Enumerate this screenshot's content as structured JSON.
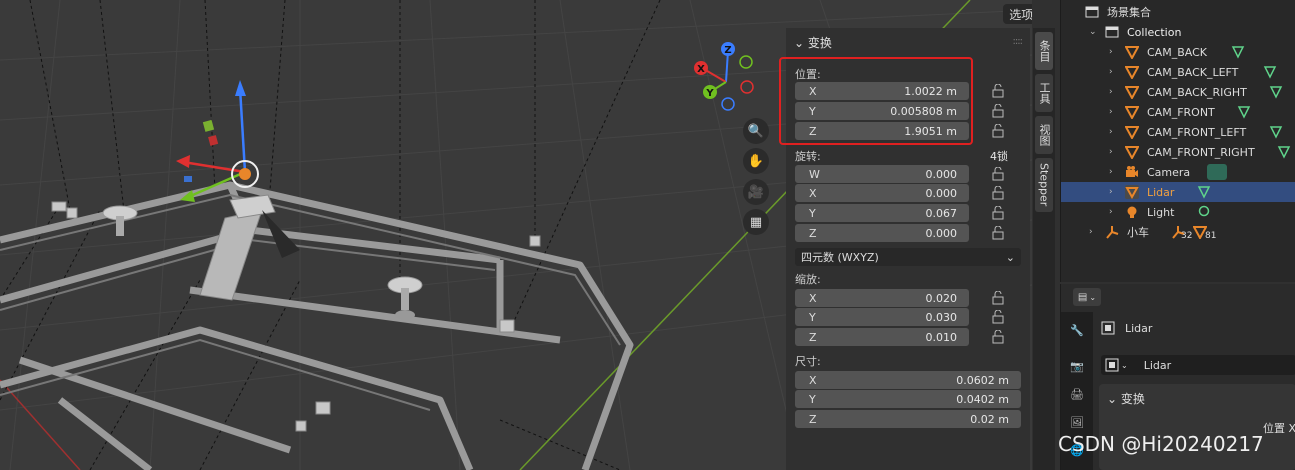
{
  "viewport": {
    "options_label": "选项"
  },
  "gizmo": {
    "x": "X",
    "y": "Y",
    "z": "Z"
  },
  "npanel": {
    "title": "变换",
    "location_label": "位置:",
    "location": [
      {
        "axis": "X",
        "value": "1.0022 m"
      },
      {
        "axis": "Y",
        "value": "0.005808 m"
      },
      {
        "axis": "Z",
        "value": "1.9051 m"
      }
    ],
    "rotation_label": "旋转:",
    "rotation_lock_label": "4锁",
    "rotation": [
      {
        "axis": "W",
        "value": "0.000"
      },
      {
        "axis": "X",
        "value": "0.000"
      },
      {
        "axis": "Y",
        "value": "0.067"
      },
      {
        "axis": "Z",
        "value": "0.000"
      }
    ],
    "rotation_mode": "四元数 (WXYZ)",
    "scale_label": "缩放:",
    "scale": [
      {
        "axis": "X",
        "value": "0.020"
      },
      {
        "axis": "Y",
        "value": "0.030"
      },
      {
        "axis": "Z",
        "value": "0.010"
      }
    ],
    "dimensions_label": "尺寸:",
    "dimensions": [
      {
        "axis": "X",
        "value": "0.0602 m"
      },
      {
        "axis": "Y",
        "value": "0.0402 m"
      },
      {
        "axis": "Z",
        "value": "0.02 m"
      }
    ]
  },
  "tabs": [
    "条目",
    "工具",
    "视图",
    "Stepper"
  ],
  "outliner": {
    "scene_collection": "场景集合",
    "collection": "Collection",
    "items": [
      {
        "name": "CAM_BACK",
        "type": "camera"
      },
      {
        "name": "CAM_BACK_LEFT",
        "type": "camera"
      },
      {
        "name": "CAM_BACK_RIGHT",
        "type": "camera"
      },
      {
        "name": "CAM_FRONT",
        "type": "camera"
      },
      {
        "name": "CAM_FRONT_LEFT",
        "type": "camera"
      },
      {
        "name": "CAM_FRONT_RIGHT",
        "type": "camera"
      },
      {
        "name": "Camera",
        "type": "camera"
      },
      {
        "name": "Lidar",
        "type": "camera",
        "selected": true
      },
      {
        "name": "Light",
        "type": "light"
      }
    ],
    "armature": {
      "name": "小车",
      "count_a": "32",
      "count_b": "81"
    }
  },
  "properties": {
    "object_name": "Lidar",
    "object_field": "Lidar",
    "transform_title": "变换",
    "location_label": "位置 X"
  },
  "watermark": "CSDN @Hi20240217",
  "colors": {
    "accent_orange": "#e8862a",
    "selection_blue": "#334d80",
    "highlight_red": "#e02020",
    "data_green": "#5fd38a"
  }
}
